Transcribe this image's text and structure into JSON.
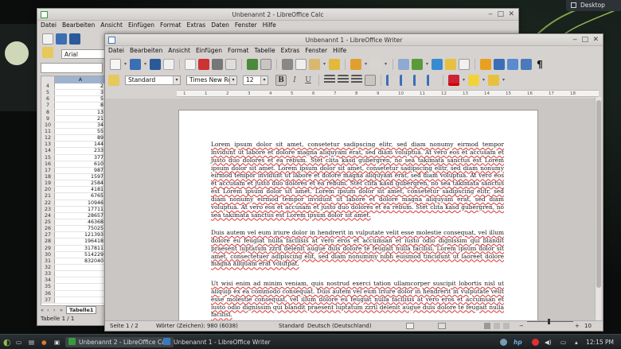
{
  "desktop": {
    "button_label": "Desktop",
    "accent": "#7da24a"
  },
  "calc": {
    "title": "Unbenannt 2 - LibreOffice Calc",
    "menu": [
      "Datei",
      "Bearbeiten",
      "Ansicht",
      "Einfügen",
      "Format",
      "Extras",
      "Daten",
      "Fenster",
      "Hilfe"
    ],
    "font_name": "Arial",
    "column_header": "A",
    "rows": [
      {
        "n": "4",
        "v": "2"
      },
      {
        "n": "5",
        "v": "3"
      },
      {
        "n": "6",
        "v": "5"
      },
      {
        "n": "7",
        "v": "8"
      },
      {
        "n": "8",
        "v": "13"
      },
      {
        "n": "9",
        "v": "21"
      },
      {
        "n": "10",
        "v": "34"
      },
      {
        "n": "11",
        "v": "55"
      },
      {
        "n": "12",
        "v": "89"
      },
      {
        "n": "13",
        "v": "144"
      },
      {
        "n": "14",
        "v": "233"
      },
      {
        "n": "15",
        "v": "377"
      },
      {
        "n": "16",
        "v": "610"
      },
      {
        "n": "17",
        "v": "987"
      },
      {
        "n": "18",
        "v": "1597"
      },
      {
        "n": "19",
        "v": "2584"
      },
      {
        "n": "20",
        "v": "4181"
      },
      {
        "n": "21",
        "v": "6765"
      },
      {
        "n": "22",
        "v": "10946"
      },
      {
        "n": "23",
        "v": "17711"
      },
      {
        "n": "24",
        "v": "28657"
      },
      {
        "n": "25",
        "v": "46368"
      },
      {
        "n": "26",
        "v": "75025"
      },
      {
        "n": "27",
        "v": "121393"
      },
      {
        "n": "28",
        "v": "196418"
      },
      {
        "n": "29",
        "v": "317811"
      },
      {
        "n": "30",
        "v": "514229"
      },
      {
        "n": "31",
        "v": "832040"
      },
      {
        "n": "32",
        "v": ""
      },
      {
        "n": "33",
        "v": ""
      },
      {
        "n": "34",
        "v": ""
      },
      {
        "n": "35",
        "v": ""
      },
      {
        "n": "36",
        "v": ""
      },
      {
        "n": "37",
        "v": ""
      }
    ],
    "sheet_tab": "Tabelle1",
    "status": "Tabelle 1 / 1"
  },
  "writer": {
    "title": "Unbenannt 1 - LibreOffice Writer",
    "menu": [
      "Datei",
      "Bearbeiten",
      "Ansicht",
      "Einfügen",
      "Format",
      "Tabelle",
      "Extras",
      "Fenster",
      "Hilfe"
    ],
    "style": "Standard",
    "font": "Times New Ro",
    "size": "12",
    "ruler_marks": [
      "1",
      "1",
      "2",
      "3",
      "4",
      "5",
      "6",
      "7",
      "8",
      "9",
      "10",
      "11",
      "12",
      "13",
      "14",
      "15",
      "16",
      "17",
      "18"
    ],
    "paragraphs": [
      "Lorem ipsum dolor sit amet, consetetur sadipscing elitr, sed diam nonumy eirmod tempor invidunt ut labore et dolore magna aliquyam erat, sed diam voluptua. At vero eos et accusam et justo duo dolores et ea rebum. Stet clita kasd gubergren, no sea takimata sanctus est Lorem ipsum dolor sit amet. Lorem ipsum dolor sit amet, consetetur sadipscing elitr, sed diam nonumy eirmod tempor invidunt ut labore et dolore magna aliquyam erat, sed diam voluptua. At vero eos et accusam et justo duo dolores et ea rebum. Stet clita kasd gubergren, no sea takimata sanctus est Lorem ipsum dolor sit amet. Lorem ipsum dolor sit amet, consetetur sadipscing elitr, sed diam nonumy eirmod tempor invidunt ut labore et dolore magna aliquyam erat, sed diam voluptua. At vero eos et accusam et justo duo dolores et ea rebum. Stet clita kasd gubergren, no sea takimata sanctus est Lorem ipsum dolor sit amet.",
      "Duis autem vel eum iriure dolor in hendrerit in vulputate velit esse molestie consequat, vel illum dolore eu feugiat nulla facilisis at vero eros et accumsan et iusto odio dignissim qui blandit praesent luptatum zzril delenit augue duis dolore te feugait nulla facilisi. Lorem ipsum dolor sit amet, consectetuer adipiscing elit, sed diam nonummy nibh euismod tincidunt ut laoreet dolore magna aliquam erat volutpat.",
      "Ut wisi enim ad minim veniam, quis nostrud exerci tation ullamcorper suscipit lobortis nisl ut aliquip ex ea commodo consequat. Duis autem vel eum iriure dolor in hendrerit in vulputate velit esse molestie consequat, vel illum dolore eu feugiat nulla facilisis at vero eros et accumsan et iusto odio dignissim qui blandit praesent luptatum zzril delenit augue duis dolore te feugait nulla facilisi."
    ],
    "status": {
      "page": "Seite 1 / 2",
      "words": "Wörter (Zeichen): 980 (6038)",
      "style": "Standard",
      "language": "Deutsch (Deutschland)"
    },
    "zoom_end_label": "10"
  },
  "taskbar": {
    "items": [
      {
        "label": "Unbenannt 2 - LibreOffice Calc",
        "color": "#3a9a3a"
      },
      {
        "label": "Unbenannt 1 - LibreOffice Writer",
        "color": "#3a79c0"
      }
    ],
    "clock": "12:15 PM"
  }
}
